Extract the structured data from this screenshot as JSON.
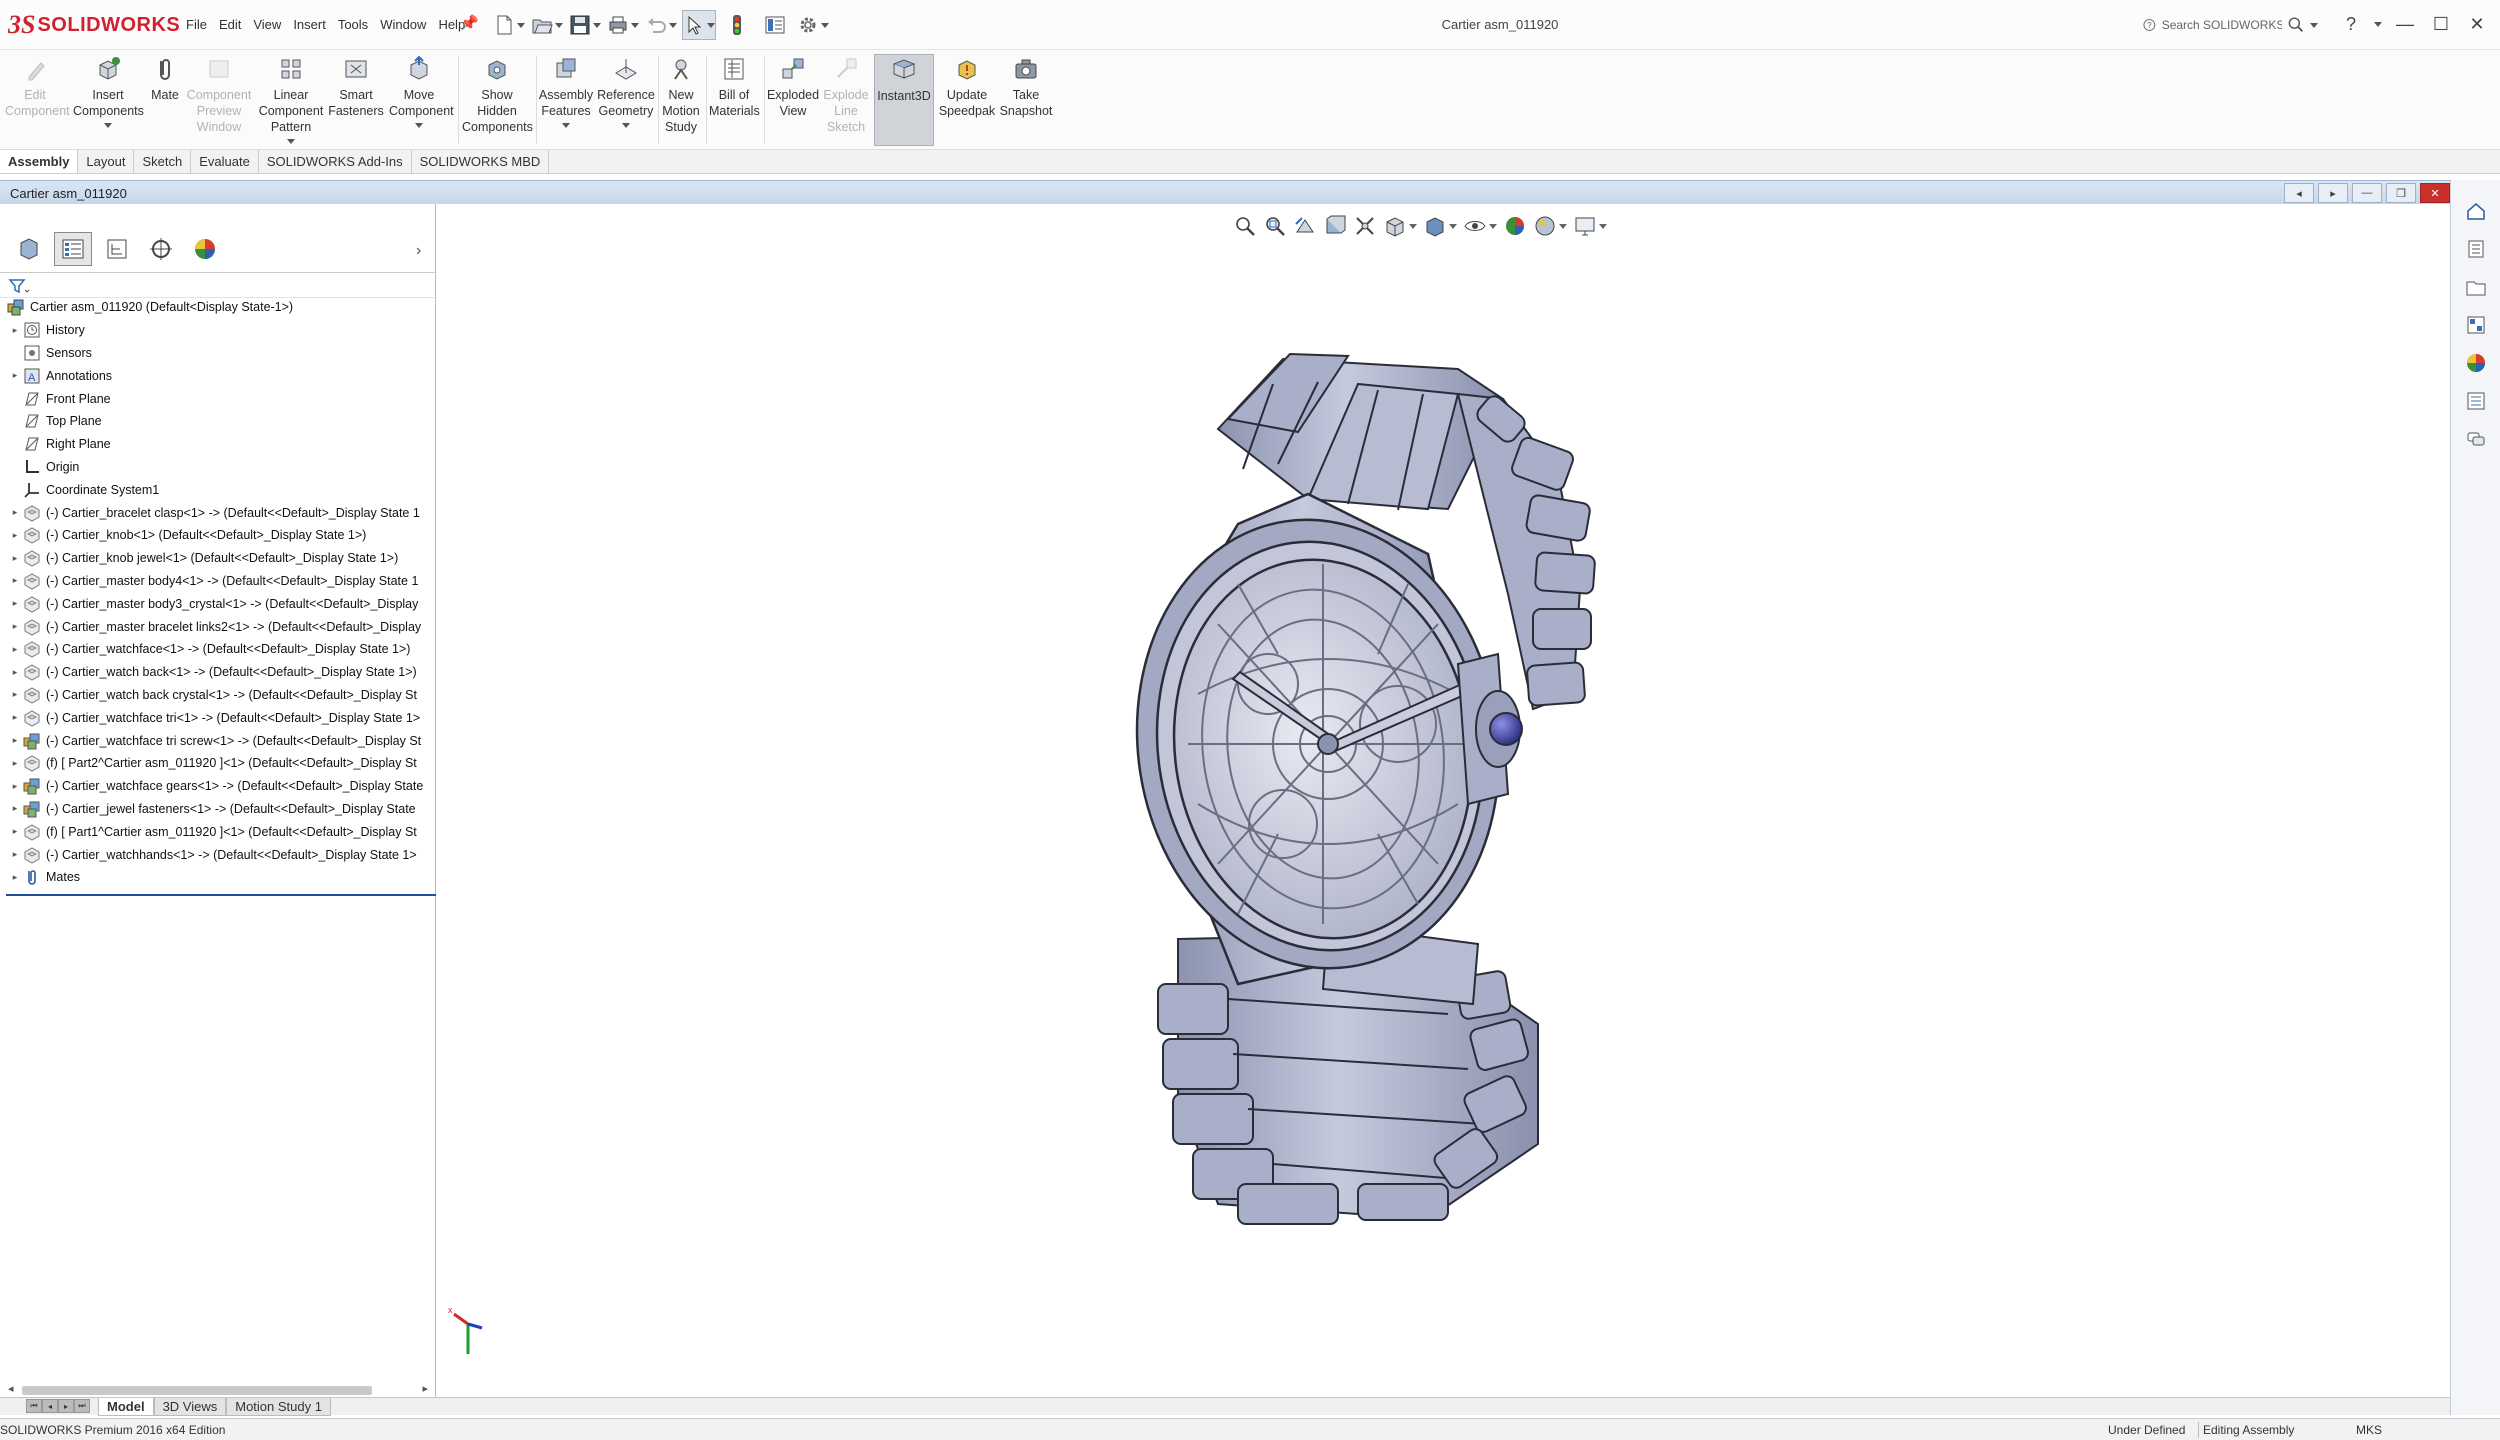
{
  "app": {
    "brand": "SOLIDWORKS",
    "title": "Cartier asm_011920"
  },
  "menu": [
    "File",
    "Edit",
    "View",
    "Insert",
    "Tools",
    "Window",
    "Help"
  ],
  "search": {
    "placeholder": "Search SOLIDWORKS Help"
  },
  "ribbon": {
    "edit_component": "Edit Component",
    "insert_components": "Insert Components",
    "mate": "Mate",
    "component_preview_window": "Component Preview Window",
    "linear_component_pattern": "Linear Component Pattern",
    "smart_fasteners": "Smart Fasteners",
    "move_component": "Move Component",
    "show_hidden_components": "Show Hidden Components",
    "assembly_features": "Assembly Features",
    "reference_geometry": "Reference Geometry",
    "new_motion_study": "New Motion Study",
    "bill_of_materials": "Bill of Materials",
    "exploded_view": "Exploded View",
    "explode_line_sketch": "Explode Line Sketch",
    "instant3d": "Instant3D",
    "update_speedpak": "Update Speedpak",
    "take_snapshot": "Take Snapshot"
  },
  "command_tabs": [
    "Assembly",
    "Layout",
    "Sketch",
    "Evaluate",
    "SOLIDWORKS Add-Ins",
    "SOLIDWORKS MBD"
  ],
  "document": {
    "tab_title": "Cartier asm_011920"
  },
  "tree": {
    "root": "Cartier asm_011920  (Default<Display State-1>)",
    "items": [
      {
        "label": "History",
        "expand": true,
        "icon": "history"
      },
      {
        "label": "Sensors",
        "expand": false,
        "icon": "sensors"
      },
      {
        "label": "Annotations",
        "expand": true,
        "icon": "annotations"
      },
      {
        "label": "Front Plane",
        "expand": false,
        "icon": "plane"
      },
      {
        "label": "Top Plane",
        "expand": false,
        "icon": "plane"
      },
      {
        "label": "Right Plane",
        "expand": false,
        "icon": "plane"
      },
      {
        "label": "Origin",
        "expand": false,
        "icon": "origin"
      },
      {
        "label": "Coordinate System1",
        "expand": false,
        "icon": "coord"
      },
      {
        "label": "(-) Cartier_bracelet clasp<1> -> (Default<<Default>_Display State 1",
        "expand": true,
        "icon": "part"
      },
      {
        "label": "(-) Cartier_knob<1> (Default<<Default>_Display State 1>)",
        "expand": true,
        "icon": "part"
      },
      {
        "label": "(-) Cartier_knob jewel<1> (Default<<Default>_Display State 1>)",
        "expand": true,
        "icon": "part"
      },
      {
        "label": "(-) Cartier_master body4<1> -> (Default<<Default>_Display State 1",
        "expand": true,
        "icon": "part"
      },
      {
        "label": "(-) Cartier_master body3_crystal<1> -> (Default<<Default>_Display",
        "expand": true,
        "icon": "part"
      },
      {
        "label": "(-) Cartier_master bracelet links2<1> -> (Default<<Default>_Display",
        "expand": true,
        "icon": "part"
      },
      {
        "label": "(-) Cartier_watchface<1> -> (Default<<Default>_Display State 1>)",
        "expand": true,
        "icon": "part"
      },
      {
        "label": "(-) Cartier_watch back<1> -> (Default<<Default>_Display State 1>)",
        "expand": true,
        "icon": "part"
      },
      {
        "label": "(-) Cartier_watch back crystal<1> -> (Default<<Default>_Display St",
        "expand": true,
        "icon": "part"
      },
      {
        "label": "(-) Cartier_watchface tri<1> -> (Default<<Default>_Display State 1>",
        "expand": true,
        "icon": "part"
      },
      {
        "label": "(-) Cartier_watchface tri screw<1> -> (Default<<Default>_Display St",
        "expand": true,
        "icon": "subasm"
      },
      {
        "label": "(f) [ Part2^Cartier asm_011920 ]<1> (Default<<Default>_Display St",
        "expand": true,
        "icon": "part"
      },
      {
        "label": "(-) Cartier_watchface gears<1> -> (Default<<Default>_Display State",
        "expand": true,
        "icon": "subasm"
      },
      {
        "label": "(-) Cartier_jewel fasteners<1> -> (Default<<Default>_Display State",
        "expand": true,
        "icon": "subasm"
      },
      {
        "label": "(f) [ Part1^Cartier asm_011920 ]<1> (Default<<Default>_Display St",
        "expand": true,
        "icon": "part"
      },
      {
        "label": "(-) Cartier_watchhands<1> -> (Default<<Default>_Display State 1>",
        "expand": true,
        "icon": "part"
      },
      {
        "label": "Mates",
        "expand": true,
        "icon": "mates"
      }
    ]
  },
  "bottom_tabs": [
    "Model",
    "3D Views",
    "Motion Study 1"
  ],
  "status": {
    "edition": "SOLIDWORKS Premium 2016 x64 Edition",
    "defined": "Under Defined",
    "mode": "Editing Assembly",
    "units": "MKS"
  },
  "colors": {
    "brand_red": "#d1202f",
    "model_fill": "#a9afc9",
    "model_edge": "#2a2c38",
    "knob_jewel": "#4b4fb0"
  }
}
